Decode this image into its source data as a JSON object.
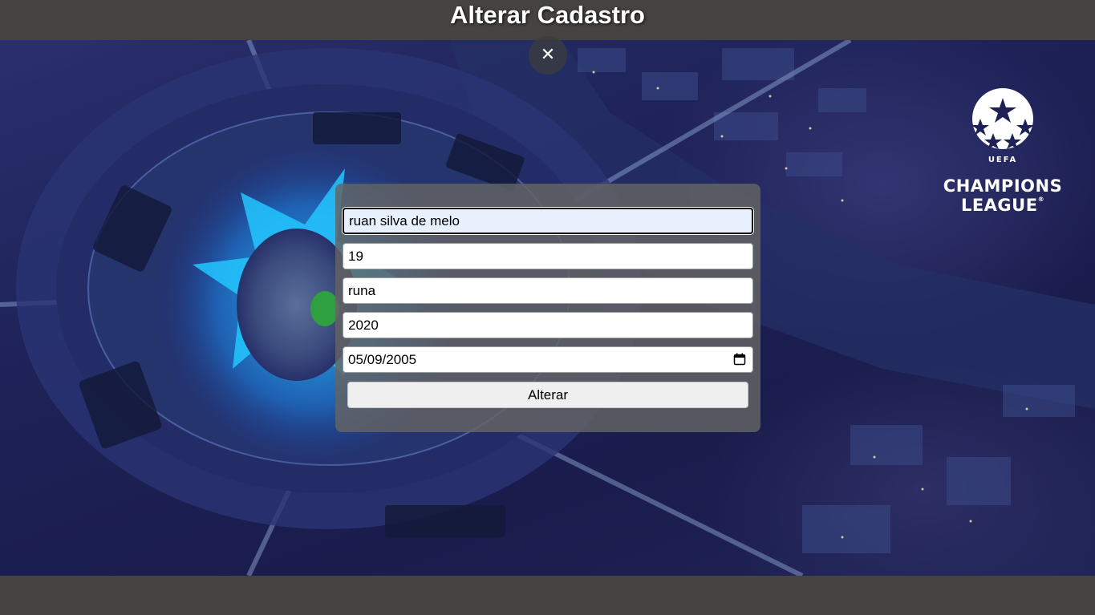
{
  "header": {
    "title": "Alterar Cadastro"
  },
  "close_button": {
    "icon": "close-icon",
    "glyph": "✕"
  },
  "logo": {
    "line1": "UEFA",
    "line2": "CHAMPIONS",
    "line3": "LEAGUE",
    "reg_mark": "®"
  },
  "form": {
    "name_value": "ruan silva de melo",
    "age_value": "19",
    "nickname_value": "runa",
    "year_value": "2020",
    "date_value": "05/09/2005",
    "submit_label": "Alterar"
  },
  "colors": {
    "header_bg": "#454341",
    "panel_bg": "#646464",
    "focused_field_bg": "#e8f0fe",
    "button_bg": "#efefef"
  }
}
